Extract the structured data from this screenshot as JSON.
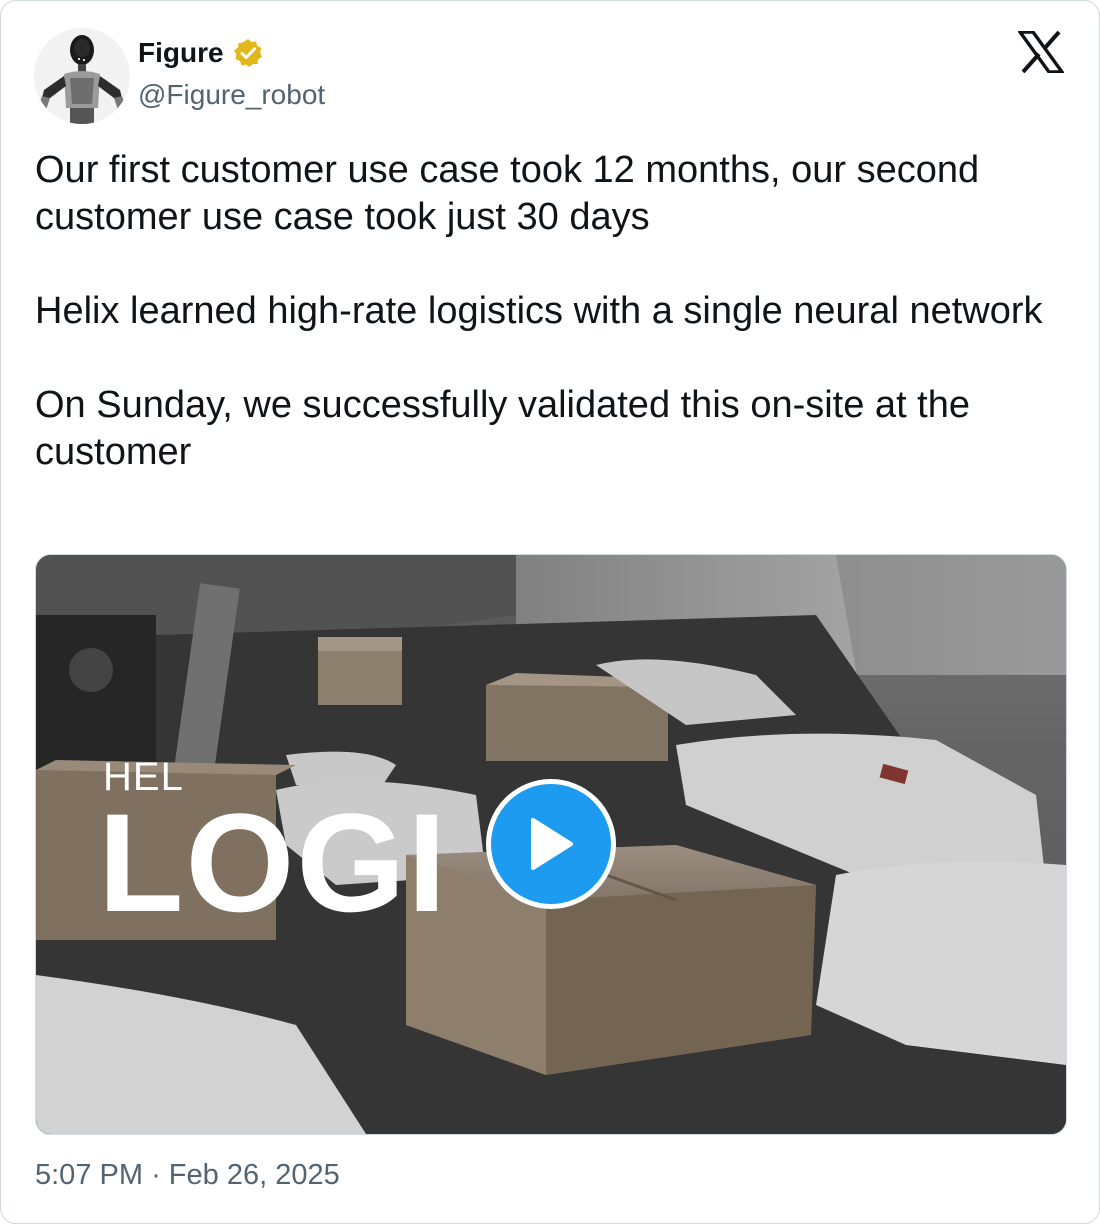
{
  "author": {
    "display_name": "Figure",
    "handle": "@Figure_robot",
    "verified_icon": "verified-badge-icon",
    "avatar_icon": "robot-avatar"
  },
  "platform_icon": "x-logo-icon",
  "tweet": {
    "paragraphs": [
      "Our first customer use case took 12 months, our second customer use case took just 30 days",
      "Helix learned high-rate logistics with a single neural network",
      "On Sunday, we successfully validated this on-site at the customer"
    ]
  },
  "media": {
    "overlay_small": "HEL",
    "overlay_big": "LOGI",
    "play_icon": "play-icon"
  },
  "meta": {
    "time": "5:07 PM",
    "separator": "·",
    "date": "Feb 26, 2025"
  },
  "colors": {
    "accent": "#1d9bf0",
    "verified_gold": "#e2b719",
    "text_primary": "#0f1419",
    "text_secondary": "#536471",
    "border": "#cfd9de"
  }
}
